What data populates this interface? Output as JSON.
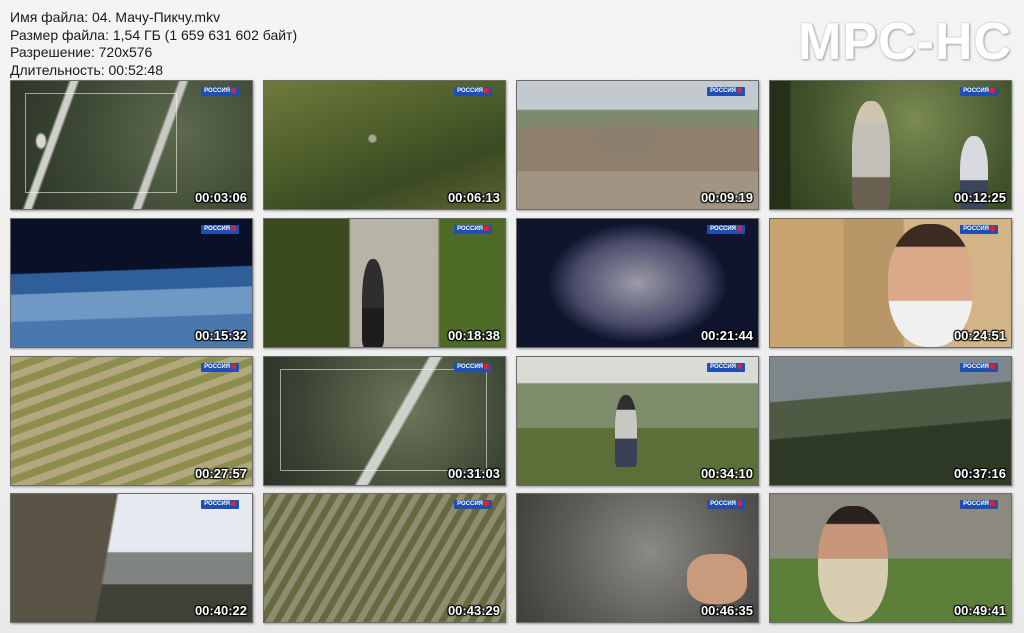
{
  "file_info": {
    "filename": "Имя файла: 04. Мачу-Пикчу.mkv",
    "filesize": "Размер файла: 1,54 ГБ (1 659 631 602 байт)",
    "resolution": "Разрешение: 720x576",
    "duration": "Длительность: 00:52:48"
  },
  "logo": "MPC-HC",
  "channel_badge": "РОССИЯ",
  "thumbnails": [
    {
      "time": "00:03:06",
      "scene": "aerial-river-map"
    },
    {
      "time": "00:06:13",
      "scene": "forest-ridge-ruins"
    },
    {
      "time": "00:09:19",
      "scene": "stone-ruins-path"
    },
    {
      "time": "00:12:25",
      "scene": "hikers-forest"
    },
    {
      "time": "00:15:32",
      "scene": "3d-terrain-blue"
    },
    {
      "time": "00:18:38",
      "scene": "stone-wall-hikers"
    },
    {
      "time": "00:21:44",
      "scene": "stone-wall-closeup"
    },
    {
      "time": "00:24:51",
      "scene": "interview-man"
    },
    {
      "time": "00:27:57",
      "scene": "terraces-aerial"
    },
    {
      "time": "00:31:03",
      "scene": "aerial-river-map-2"
    },
    {
      "time": "00:34:10",
      "scene": "hiker-on-trail"
    },
    {
      "time": "00:37:16",
      "scene": "mountain-terraces"
    },
    {
      "time": "00:40:22",
      "scene": "stone-wall-sky"
    },
    {
      "time": "00:43:29",
      "scene": "ruins-overview"
    },
    {
      "time": "00:46:35",
      "scene": "hand-on-rock"
    },
    {
      "time": "00:49:41",
      "scene": "presenter-ruins"
    }
  ]
}
